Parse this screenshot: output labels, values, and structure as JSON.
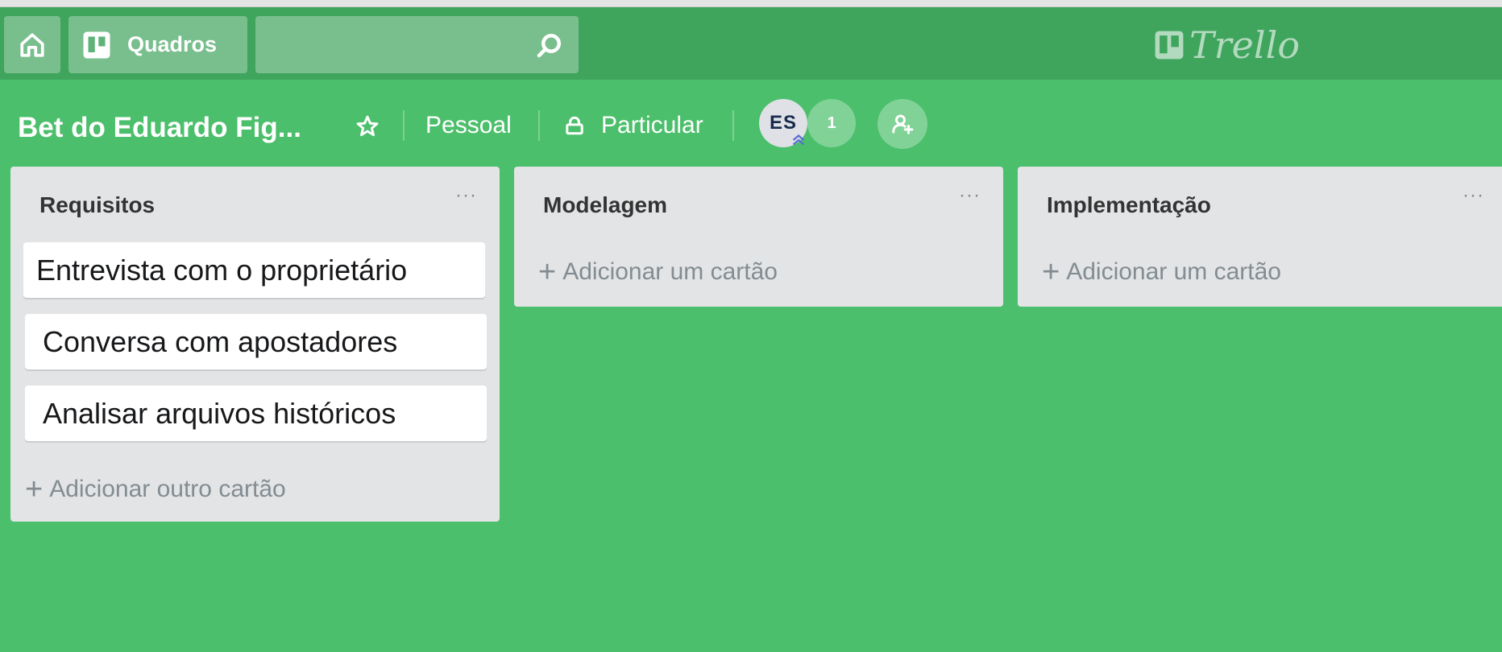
{
  "header": {
    "home_icon": "home-icon",
    "boards_label": "Quadros",
    "boards_icon": "boards-icon",
    "search_placeholder": "",
    "search_icon": "search-icon",
    "logo_text": "Trello"
  },
  "board": {
    "title": "Bet do Eduardo Fig...",
    "star_icon": "star-icon",
    "team_label": "Pessoal",
    "visibility_label": "Particular",
    "visibility_icon": "lock-icon",
    "member_initials": "ES",
    "member_count": "1",
    "invite_icon": "add-member-icon"
  },
  "lists": [
    {
      "title": "Requisitos",
      "menu": "···",
      "cards": [
        "Entrevista com o proprietário",
        "Conversa com apostadores",
        "Analisar arquivos históricos"
      ],
      "add_label": "Adicionar outro cartão"
    },
    {
      "title": "Modelagem",
      "menu": "···",
      "cards": [],
      "add_label": "Adicionar um cartão"
    },
    {
      "title": "Implementação",
      "menu": "···",
      "cards": [],
      "add_label": "Adicionar um cartão"
    }
  ],
  "colors": {
    "board_bg": "#4bbf6b",
    "header_bg": "#3fa45c",
    "list_bg": "#e2e4e6"
  }
}
